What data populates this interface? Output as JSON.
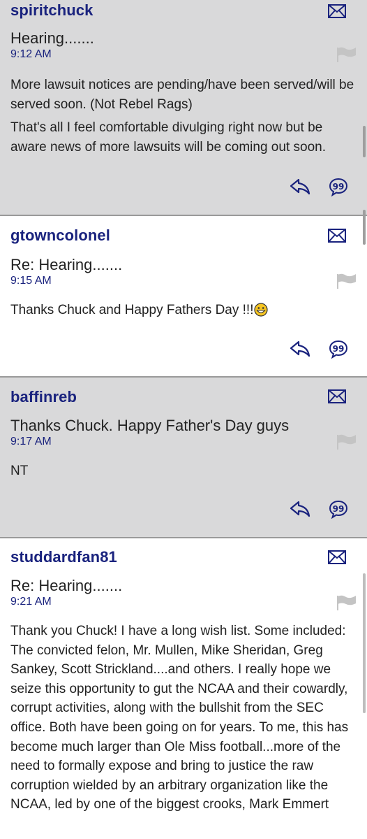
{
  "posts": [
    {
      "username": "spiritchuck",
      "subject": "Hearing.......",
      "time": "9:12 AM",
      "paragraphs": [
        "More lawsuit notices are pending/have been served/will be served soon. (Not Rebel Rags)",
        "That's all I feel comfortable divulging right now but be aware news of more lawsuits will be coming out soon."
      ]
    },
    {
      "username": "gtowncolonel",
      "subject": "Re: Hearing.......",
      "time": "9:15 AM",
      "paragraphs": [
        "Thanks Chuck and Happy Fathers Day !!!"
      ]
    },
    {
      "username": "baffinreb",
      "subject": "Thanks Chuck. Happy Father's Day guys",
      "time": "9:17 AM",
      "paragraphs": [
        "NT"
      ]
    },
    {
      "username": "studdardfan81",
      "subject": "Re: Hearing.......",
      "time": "9:21 AM",
      "paragraphs": [
        "Thank you Chuck! I have a long wish list. Some included: The convicted felon, Mr. Mullen, Mike Sheridan, Greg Sankey, Scott Strickland....and others. I really hope we seize this opportunity to gut the NCAA and their cowardly, corrupt activities, along with the bullshit from the SEC office. Both have been going on for years. To me, this has become much larger than Ole Miss football...more of the need to formally expose and bring to justice the raw corruption wielded by an arbitrary organization like the NCAA, led by one of the biggest crooks, Mark Emmert"
      ]
    }
  ],
  "icons": {
    "message": "envelope-icon",
    "flag": "flag-icon",
    "reply": "reply-icon",
    "quote": "quote-icon",
    "emoji": "grinning-face-emoji"
  },
  "colors": {
    "username": "#1a237e",
    "time": "#1a237e",
    "icon": "#1a237e",
    "gray_background": "#d9d9da",
    "flag": "#b8b8b8"
  }
}
